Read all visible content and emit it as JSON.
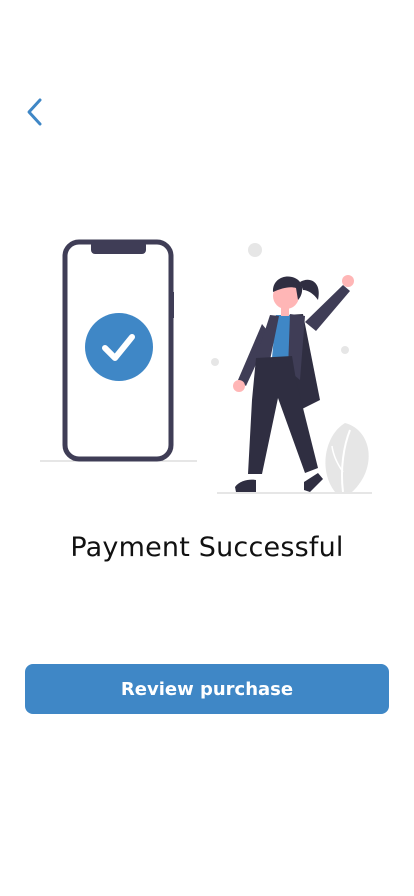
{
  "header": {
    "back_icon": "chevron-left-icon"
  },
  "illustration": {
    "description_icon": "payment-success-illustration",
    "check_icon": "checkmark-icon"
  },
  "content": {
    "title": "Payment Successful"
  },
  "actions": {
    "review_label": "Review purchase"
  },
  "colors": {
    "accent": "#3f87c6",
    "dark": "#3f3d56",
    "skin": "#ffb6b6",
    "shirt": "#3f87c6",
    "ground": "#cccccc"
  }
}
